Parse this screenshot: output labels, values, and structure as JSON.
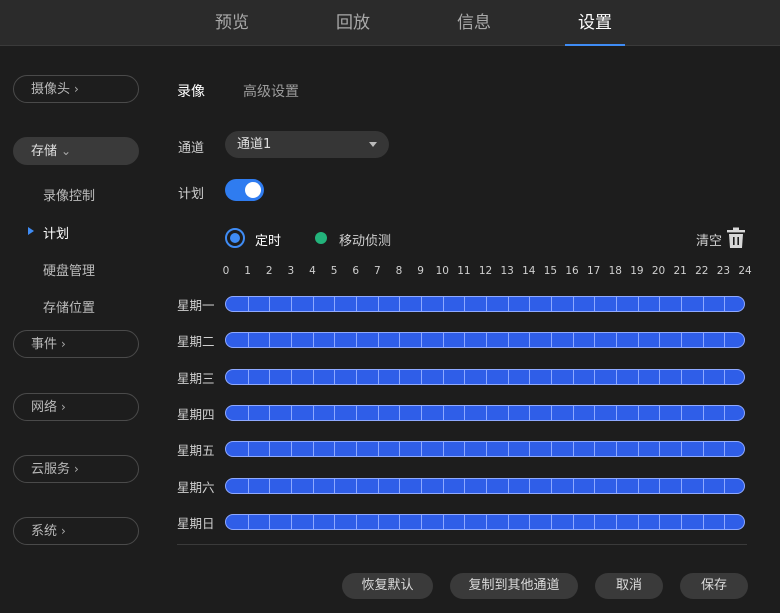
{
  "nav": {
    "tabs": [
      {
        "label": "预览"
      },
      {
        "label": "回放"
      },
      {
        "label": "信息"
      },
      {
        "label": "设置",
        "active": true
      }
    ]
  },
  "sidebar": {
    "camera": "摄像头",
    "storage": "存储",
    "storage_items": [
      "录像控制",
      "计划",
      "硬盘管理",
      "存储位置"
    ],
    "active_item": "计划",
    "events": "事件",
    "network": "网络",
    "cloud": "云服务",
    "system": "系统"
  },
  "content": {
    "subtabs": [
      "录像",
      "高级设置"
    ],
    "channel_label": "通道",
    "channel_value": "通道1",
    "schedule_label": "计划",
    "schedule_enabled": true,
    "mode_timed": "定时",
    "mode_motion": "移动侦测",
    "clear_label": "清空",
    "hours": [
      "0",
      "1",
      "2",
      "3",
      "4",
      "5",
      "6",
      "7",
      "8",
      "9",
      "10",
      "11",
      "12",
      "13",
      "14",
      "15",
      "16",
      "17",
      "18",
      "19",
      "20",
      "21",
      "22",
      "23",
      "24"
    ],
    "days": [
      "星期一",
      "星期二",
      "星期三",
      "星期四",
      "星期五",
      "星期六",
      "星期日"
    ],
    "schedule_coverage": 1.0
  },
  "footer": {
    "restore_default": "恢复默认",
    "copy_to_channels": "复制到其他通道",
    "cancel": "取消",
    "save": "保存"
  },
  "colors": {
    "accent": "#3f8cf5",
    "timed": "#2f5ee8",
    "motion": "#23b37b",
    "background": "#1d1d1d"
  }
}
